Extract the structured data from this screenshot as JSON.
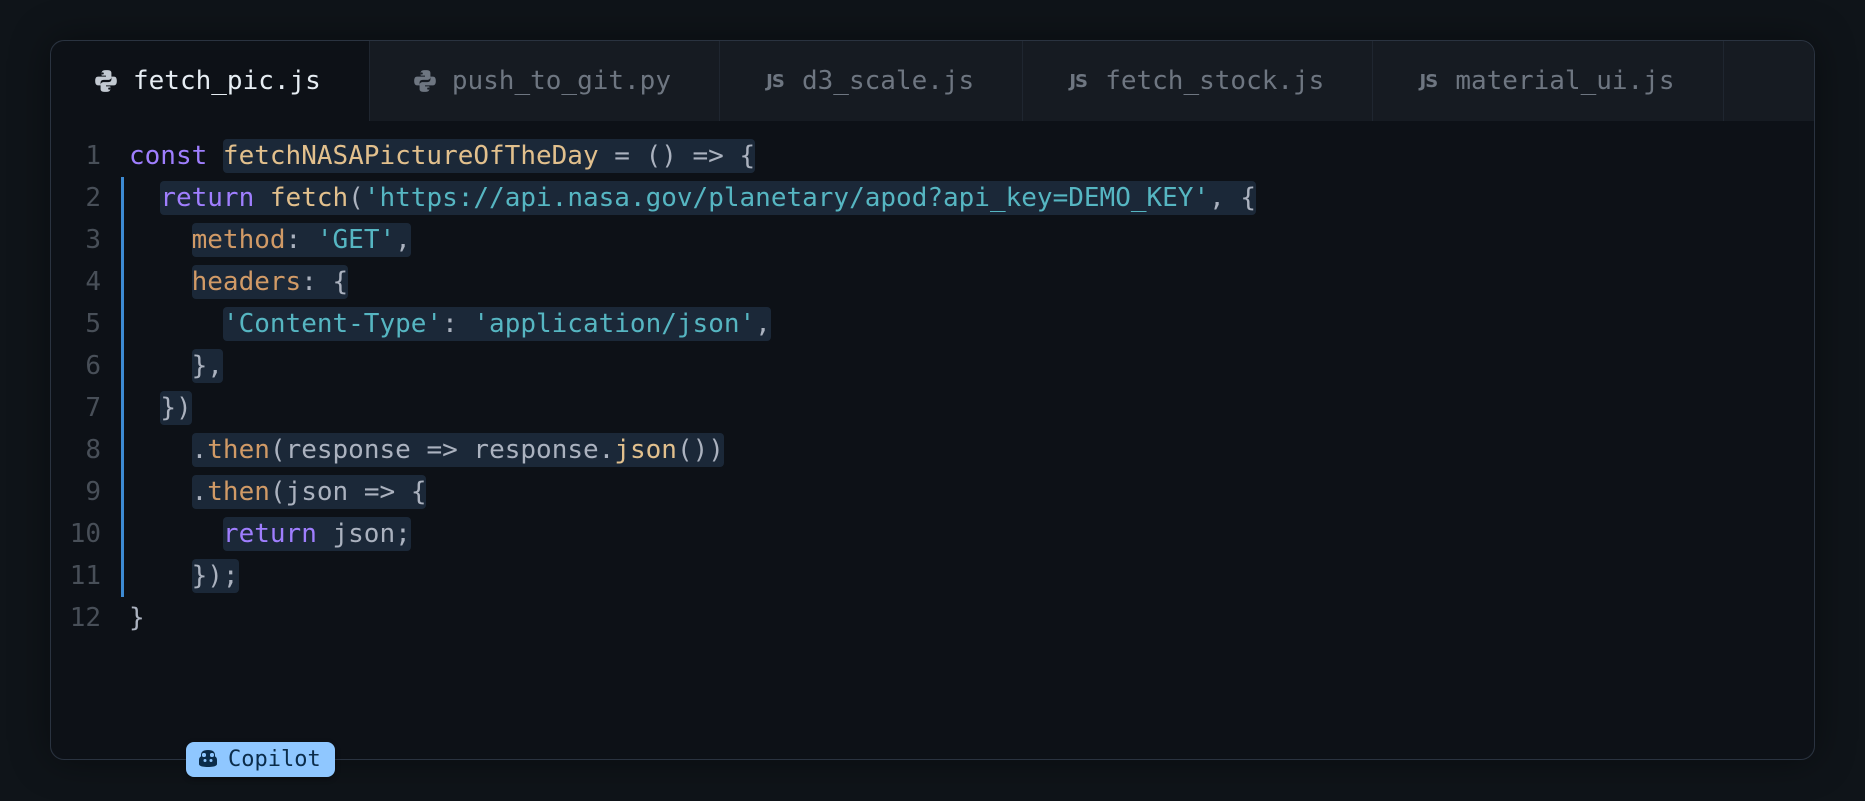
{
  "tabs": [
    {
      "label": "fetch_pic.js",
      "icon": "python",
      "active": true
    },
    {
      "label": "push_to_git.py",
      "icon": "python",
      "active": false
    },
    {
      "label": "d3_scale.js",
      "icon": "js",
      "active": false
    },
    {
      "label": "fetch_stock.js",
      "icon": "js",
      "active": false
    },
    {
      "label": "material_ui.js",
      "icon": "js",
      "active": false
    }
  ],
  "line_count": 12,
  "code": {
    "l1": {
      "kw": "const ",
      "fn": "fetchNASAPictureOfTheDay",
      "rest": " = () => {"
    },
    "l2": {
      "kw": "return ",
      "call": "fetch",
      "lp": "(",
      "str": "'https://api.nasa.gov/planetary/apod?api_key=DEMO_KEY'",
      "rest": ", {"
    },
    "l3": {
      "prop": "method",
      "colon": ": ",
      "str": "'GET'",
      "comma": ","
    },
    "l4": {
      "prop": "headers",
      "colon": ": ",
      "brace": "{"
    },
    "l5": {
      "str1": "'Content-Type'",
      "colon": ": ",
      "str2": "'application/json'",
      "comma": ","
    },
    "l6": {
      "brace": "}",
      "comma": ","
    },
    "l7": {
      "close": "})"
    },
    "l8": {
      "dot": ".",
      "call": "then",
      "lp": "(",
      "p1": "response",
      "arrow": " => ",
      "p2": "response",
      "dot2": ".",
      "call2": "json",
      "paren": "()",
      "rp": ")"
    },
    "l9": {
      "dot": ".",
      "call": "then",
      "lp": "(",
      "p1": "json",
      "arrow": " => ",
      "brace": "{"
    },
    "l10": {
      "kw": "return ",
      "ident": "json",
      "semi": ";"
    },
    "l11": {
      "close": "});"
    },
    "l12": {
      "brace": "}"
    }
  },
  "badge": {
    "label": "Copilot"
  }
}
